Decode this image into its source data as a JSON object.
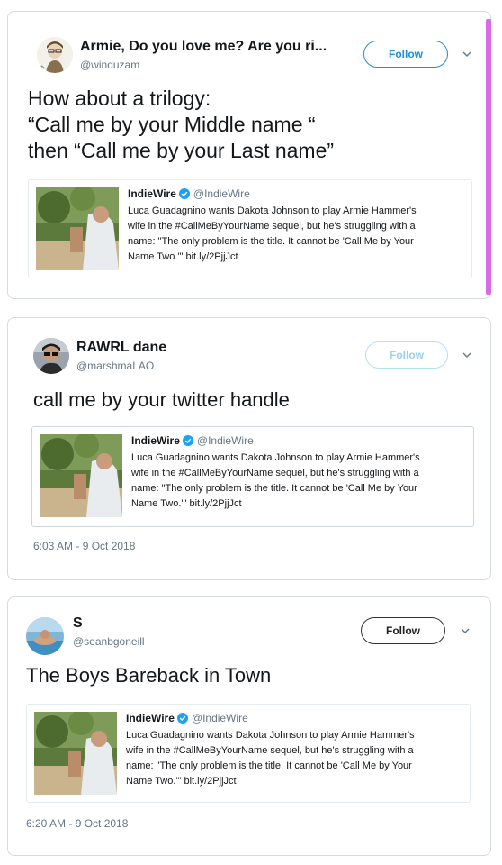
{
  "tweets": [
    {
      "display_name": "Armie, Do you love me? Are you ri...",
      "handle": "@winduzam",
      "follow_label": "Follow",
      "text_lines": [
        "How about a trilogy:",
        "“Call me by your Middle name “",
        "then “Call me by your Last name”"
      ],
      "quote": {
        "name": "IndieWire",
        "handle": "@IndieWire",
        "lines": [
          "Luca Guadagnino wants Dakota Johnson to play Armie Hammer's",
          "wife in the #CallMeByYourName sequel, but he's struggling with a",
          "name: \"The only problem is the title. It cannot be 'Call Me by Your",
          "Name Two.'\" bit.ly/2PjjJct"
        ]
      }
    },
    {
      "display_name": "RAWRL dane",
      "handle": "@marshmaLAO",
      "follow_label": "Follow",
      "text": "call me by your twitter handle",
      "quote": {
        "name": "IndieWire",
        "handle": "@IndieWire",
        "lines": [
          "Luca Guadagnino wants Dakota Johnson to play Armie Hammer's",
          "wife in the #CallMeByYourName sequel, but he's struggling with a",
          "name: \"The only problem is the title. It cannot be 'Call Me by Your",
          "Name Two.'\" bit.ly/2PjjJct"
        ]
      },
      "timestamp": "6:03 AM - 9 Oct 2018"
    },
    {
      "display_name": "S",
      "handle": "@seanbgoneill",
      "follow_label": "Follow",
      "text": "The Boys Bareback in Town",
      "quote": {
        "name": "IndieWire",
        "handle": "@IndieWire",
        "lines": [
          "Luca Guadagnino wants Dakota Johnson to play Armie Hammer's",
          "wife in the #CallMeByYourName sequel, but he's struggling with a",
          "name: \"The only problem is the title. It cannot be 'Call Me by Your",
          "Name Two.'\" bit.ly/2PjjJct"
        ]
      },
      "timestamp": "6:20 AM - 9 Oct 2018"
    }
  ],
  "colors": {
    "accent_bar": "#d96ae6",
    "follow_blue": "#1c8fd6",
    "verified_blue": "#1da1f2",
    "muted_text": "#657786"
  },
  "icons": [
    "chevron-down-icon",
    "verified-badge-icon"
  ]
}
